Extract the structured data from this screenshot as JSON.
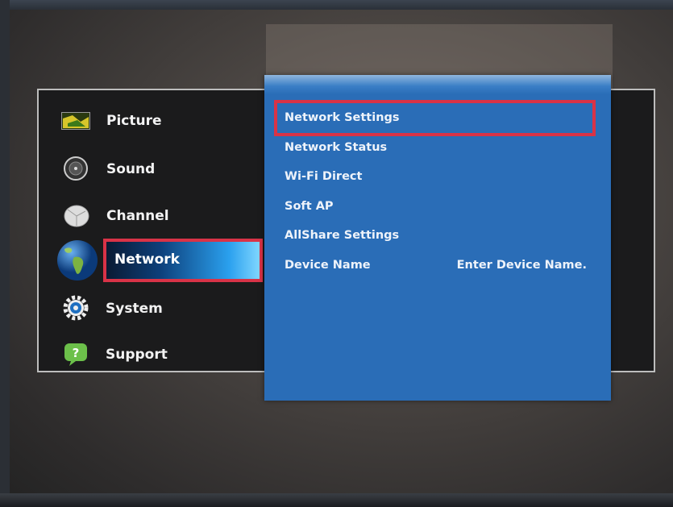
{
  "menu": {
    "items": [
      {
        "label": "Picture",
        "icon": "picture-icon"
      },
      {
        "label": "Sound",
        "icon": "speaker-icon"
      },
      {
        "label": "Channel",
        "icon": "satellite-dish-icon"
      },
      {
        "label": "Network",
        "icon": "globe-icon",
        "selected": true
      },
      {
        "label": "System",
        "icon": "gear-icon"
      },
      {
        "label": "Support",
        "icon": "help-bubble-icon"
      }
    ]
  },
  "network_submenu": {
    "items": [
      {
        "label": "Network Settings",
        "highlighted": true
      },
      {
        "label": "Network Status"
      },
      {
        "label": "Wi-Fi Direct"
      },
      {
        "label": "Soft AP"
      },
      {
        "label": "AllShare Settings"
      },
      {
        "label": "Device Name",
        "value": "Enter Device Name."
      }
    ]
  },
  "colors": {
    "highlight_border": "#d93347",
    "submenu_bg": "#2a6db7"
  }
}
